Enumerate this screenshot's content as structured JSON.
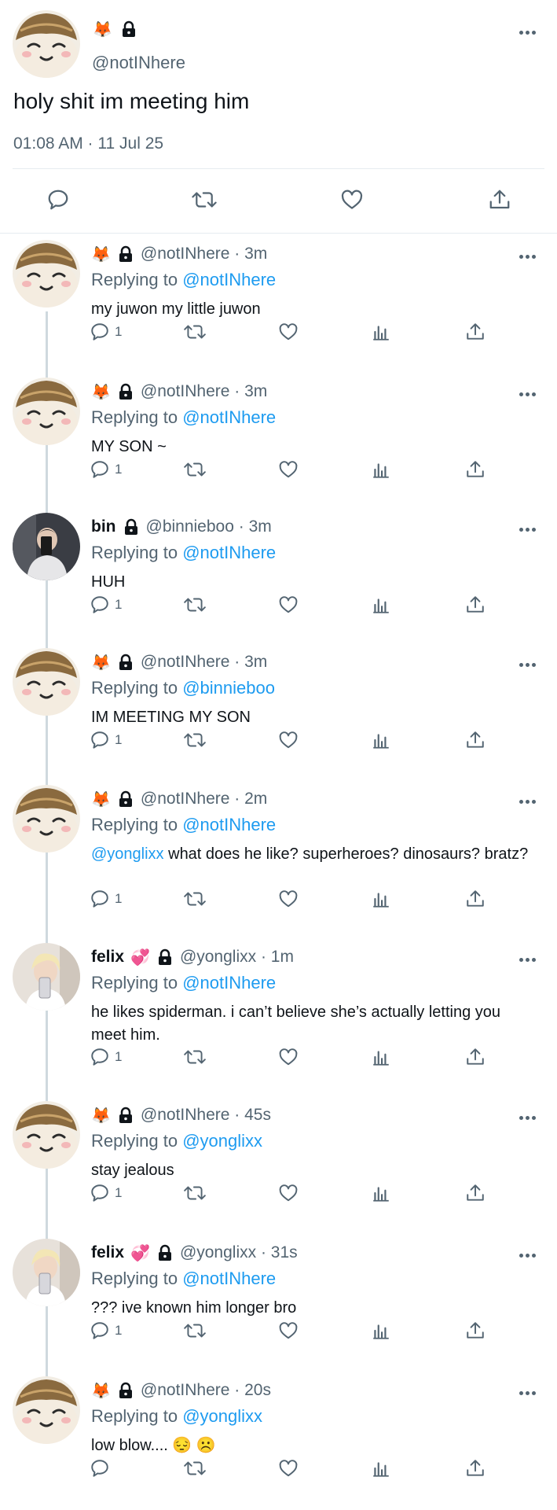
{
  "main_tweet": {
    "emojis": [
      "🦊",
      "🔒"
    ],
    "handle": "@notINhere",
    "text": "holy shit im meeting him",
    "timestamp": "01:08 AM · 11 Jul 25"
  },
  "colors": {
    "link": "#1d9bf0",
    "secondary_text": "#536471",
    "primary_text": "#0f1419",
    "thread_line": "#cfd9de"
  },
  "replies": [
    {
      "name": "",
      "emojis": [
        "🦊",
        "🔒"
      ],
      "handle_time": "@notINhere · 3m",
      "replying_label": "Replying to",
      "replying_to": "@notINhere",
      "mention": "",
      "text": "my juwon my little juwon",
      "reply_count": "1",
      "avatar": "plushie-avatar"
    },
    {
      "name": "",
      "emojis": [
        "🦊",
        "🔒"
      ],
      "handle_time": "@notINhere · 3m",
      "replying_label": "Replying to",
      "replying_to": "@notINhere",
      "mention": "",
      "text": "MY SON ~",
      "reply_count": "1",
      "avatar": "plushie-avatar"
    },
    {
      "name": "bin",
      "emojis": [
        "🔒"
      ],
      "handle_time": "@binnieboo · 3m",
      "replying_label": "Replying to",
      "replying_to": "@notINhere",
      "mention": "",
      "text": "HUH",
      "reply_count": "1",
      "avatar": "photo-avatar-bin"
    },
    {
      "name": "",
      "emojis": [
        "🦊",
        "🔒"
      ],
      "handle_time": "@notINhere · 3m",
      "replying_label": "Replying to",
      "replying_to": "@binnieboo",
      "mention": "",
      "text": "IM MEETING MY SON",
      "reply_count": "1",
      "avatar": "plushie-avatar"
    },
    {
      "name": "",
      "emojis": [
        "🦊",
        "🔒"
      ],
      "handle_time": "@notINhere · 2m",
      "replying_label": "Replying to",
      "replying_to": "@notINhere",
      "mention": "@yonglixx",
      "text": " what does he like? superheroes? dinosaurs? bratz?",
      "reply_count": "1",
      "avatar": "plushie-avatar"
    },
    {
      "name": "felix",
      "emojis": [
        "💞",
        "🔒"
      ],
      "handle_time": "@yonglixx · 1m",
      "replying_label": "Replying to",
      "replying_to": "@notINhere",
      "mention": "",
      "text": "he likes spiderman. i can’t believe she’s actually letting you meet him.",
      "reply_count": "1",
      "avatar": "photo-avatar-felix"
    },
    {
      "name": "",
      "emojis": [
        "🦊",
        "🔒"
      ],
      "handle_time": "@notINhere · 45s",
      "replying_label": "Replying to",
      "replying_to": "@yonglixx",
      "mention": "",
      "text": "stay jealous",
      "reply_count": "1",
      "avatar": "plushie-avatar"
    },
    {
      "name": "felix",
      "emojis": [
        "💞",
        "🔒"
      ],
      "handle_time": "@yonglixx · 31s",
      "replying_label": "Replying to",
      "replying_to": "@notINhere",
      "mention": "",
      "text": "??? ive known him longer bro",
      "reply_count": "1",
      "avatar": "photo-avatar-felix"
    },
    {
      "name": "",
      "emojis": [
        "🦊",
        "🔒"
      ],
      "handle_time": "@notINhere · 20s",
      "replying_label": "Replying to",
      "replying_to": "@yonglixx",
      "mention": "",
      "text": "low blow.... 😔 ☹️",
      "reply_count": "",
      "avatar": "plushie-avatar"
    }
  ]
}
